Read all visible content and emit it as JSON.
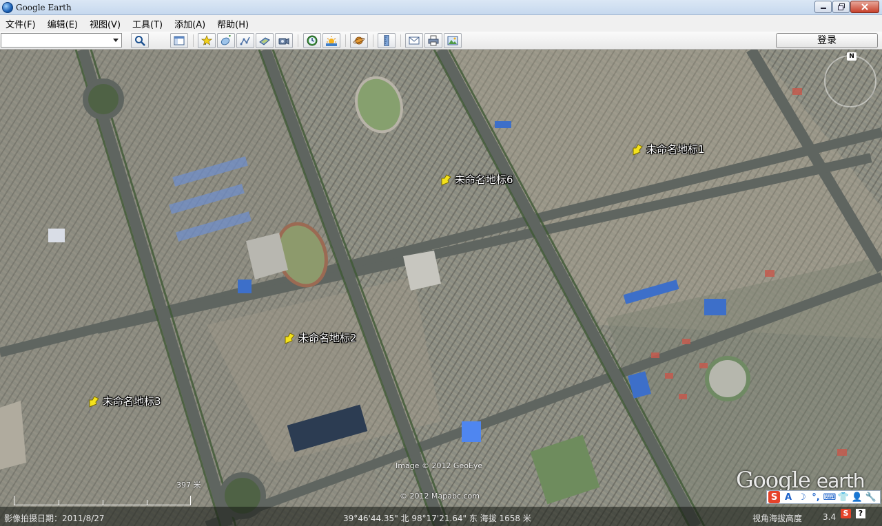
{
  "window": {
    "title": "Google Earth"
  },
  "menu": [
    "文件(F)",
    "编辑(E)",
    "视图(V)",
    "工具(T)",
    "添加(A)",
    "帮助(H)"
  ],
  "toolbar": {
    "search_value": "",
    "login_label": "登录",
    "buttons": [
      "search-icon",
      "sidebar-icon",
      "placemark-icon",
      "polygon-icon",
      "path-icon",
      "image-overlay-icon",
      "record-tour-icon",
      "historical-imagery-icon",
      "sunlight-icon",
      "planets-icon",
      "ruler-icon",
      "email-icon",
      "print-icon",
      "save-image-icon"
    ]
  },
  "map": {
    "placemarks": [
      {
        "label": "未命名地标1"
      },
      {
        "label": "未命名地标6"
      },
      {
        "label": "未命名地标2"
      },
      {
        "label": "未命名地标3"
      }
    ],
    "compass_label": "N",
    "copyright_geoeye": "Image © 2012 GeoEye",
    "copyright_mapabc": "© 2012 Mapabc.com",
    "logo_google": "Google",
    "logo_earth": "earth",
    "scale_label": "397 米",
    "pin_color": "#f4e21c"
  },
  "status": {
    "imagery_date": "影像拍摄日期：2011/8/27",
    "coordinates": "39°46'44.35\" 北  98°17'21.64\" 东  海拔  1658 米",
    "eye_alt_label": "视角海拔高度",
    "eye_alt_value": "3.4",
    "help": "?"
  },
  "ime": [
    "S",
    "A",
    "☽",
    "°,",
    "⌨",
    "👕",
    "👤",
    "🔧"
  ]
}
